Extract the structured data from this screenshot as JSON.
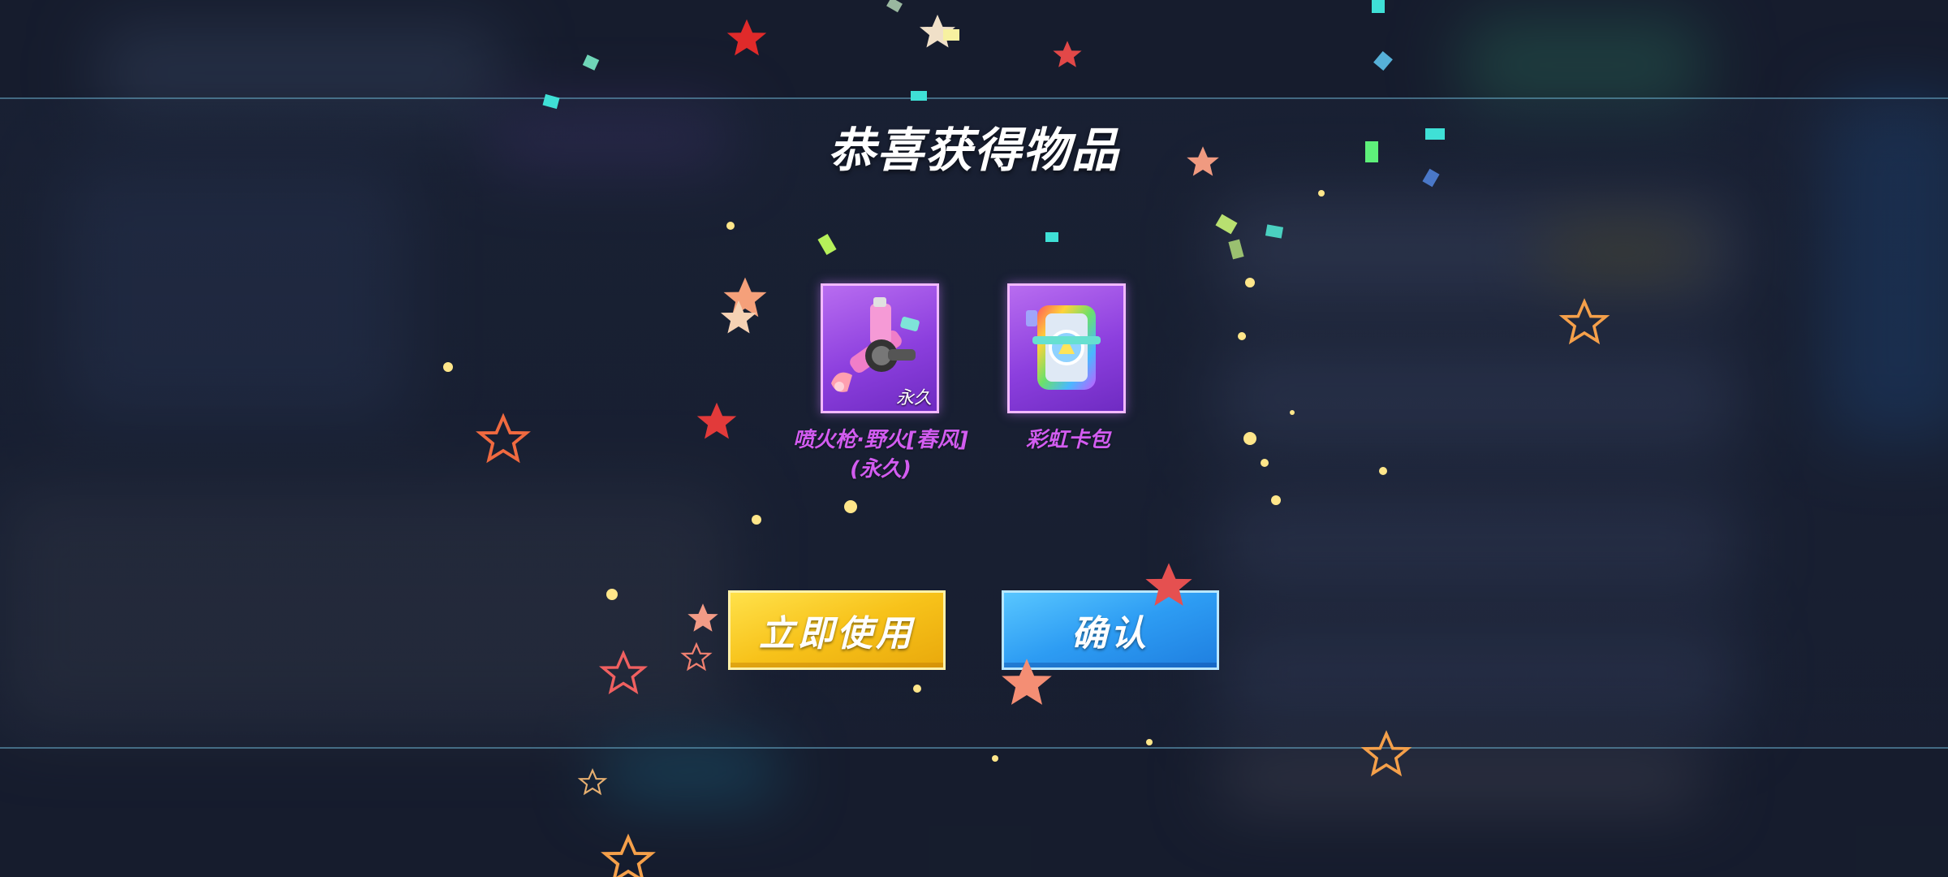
{
  "reward_dialog": {
    "title": "恭喜获得物品",
    "items": [
      {
        "name": "喷火枪·野火[春风](永久)",
        "name_line1": "喷火枪·野火[春风]",
        "name_line2": "(永久)",
        "badge": "永久",
        "icon": "flamethrower-icon"
      },
      {
        "name": "彩虹卡包",
        "name_line1": "彩虹卡包",
        "badge": "",
        "icon": "card-pack-icon"
      }
    ],
    "buttons": {
      "use_now": "立即使用",
      "confirm": "确认"
    },
    "colors": {
      "item_frame": "#f2b9ff",
      "item_name": "#d25cf0",
      "use_button": "#f7c21a",
      "confirm_button": "#2d9cf3"
    }
  }
}
